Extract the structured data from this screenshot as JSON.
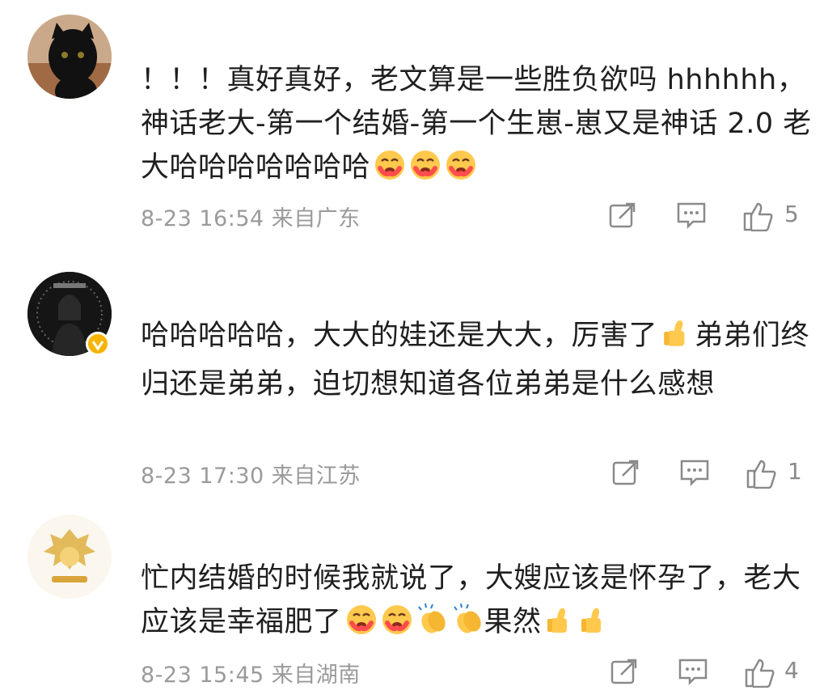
{
  "comments": [
    {
      "text": "！！！真好真好，老文算是一些胜负欲吗 hhhhhh，神话老大-第一个结婚-第一个生崽-崽又是神话 2.0 老大哈哈哈哈哈哈哈",
      "emojis": [
        "hug-face",
        "hug-face",
        "hug-face"
      ],
      "time": "8-23 16:54",
      "location": "来自广东",
      "likes": "5",
      "avatar": "black-cat"
    },
    {
      "text": "哈哈哈哈哈，大大的娃还是大大，厉害了",
      "text_after_thumb": "弟弟们终归还是弟弟，迫切想知道各位弟弟是什么感想",
      "time": "8-23 17:30",
      "location": "来自江苏",
      "likes": "1",
      "avatar": "person-photo",
      "verified": true
    },
    {
      "text": "忙内结婚的时候我就说了，大嫂应该是怀孕了，老大应该是幸福肥了",
      "emojis": [
        "hug-face",
        "hug-face",
        "clap",
        "clap"
      ],
      "text_after_emojis": "果然",
      "emojis_end": [
        "thumbs-up",
        "thumbs-up"
      ],
      "time": "8-23 15:45",
      "location": "来自湖南",
      "likes": "4",
      "avatar": "gold-emblem"
    }
  ],
  "colors": {
    "text": "#1f1f1f",
    "meta": "#9a9a9a",
    "verified": "#f6b400"
  }
}
